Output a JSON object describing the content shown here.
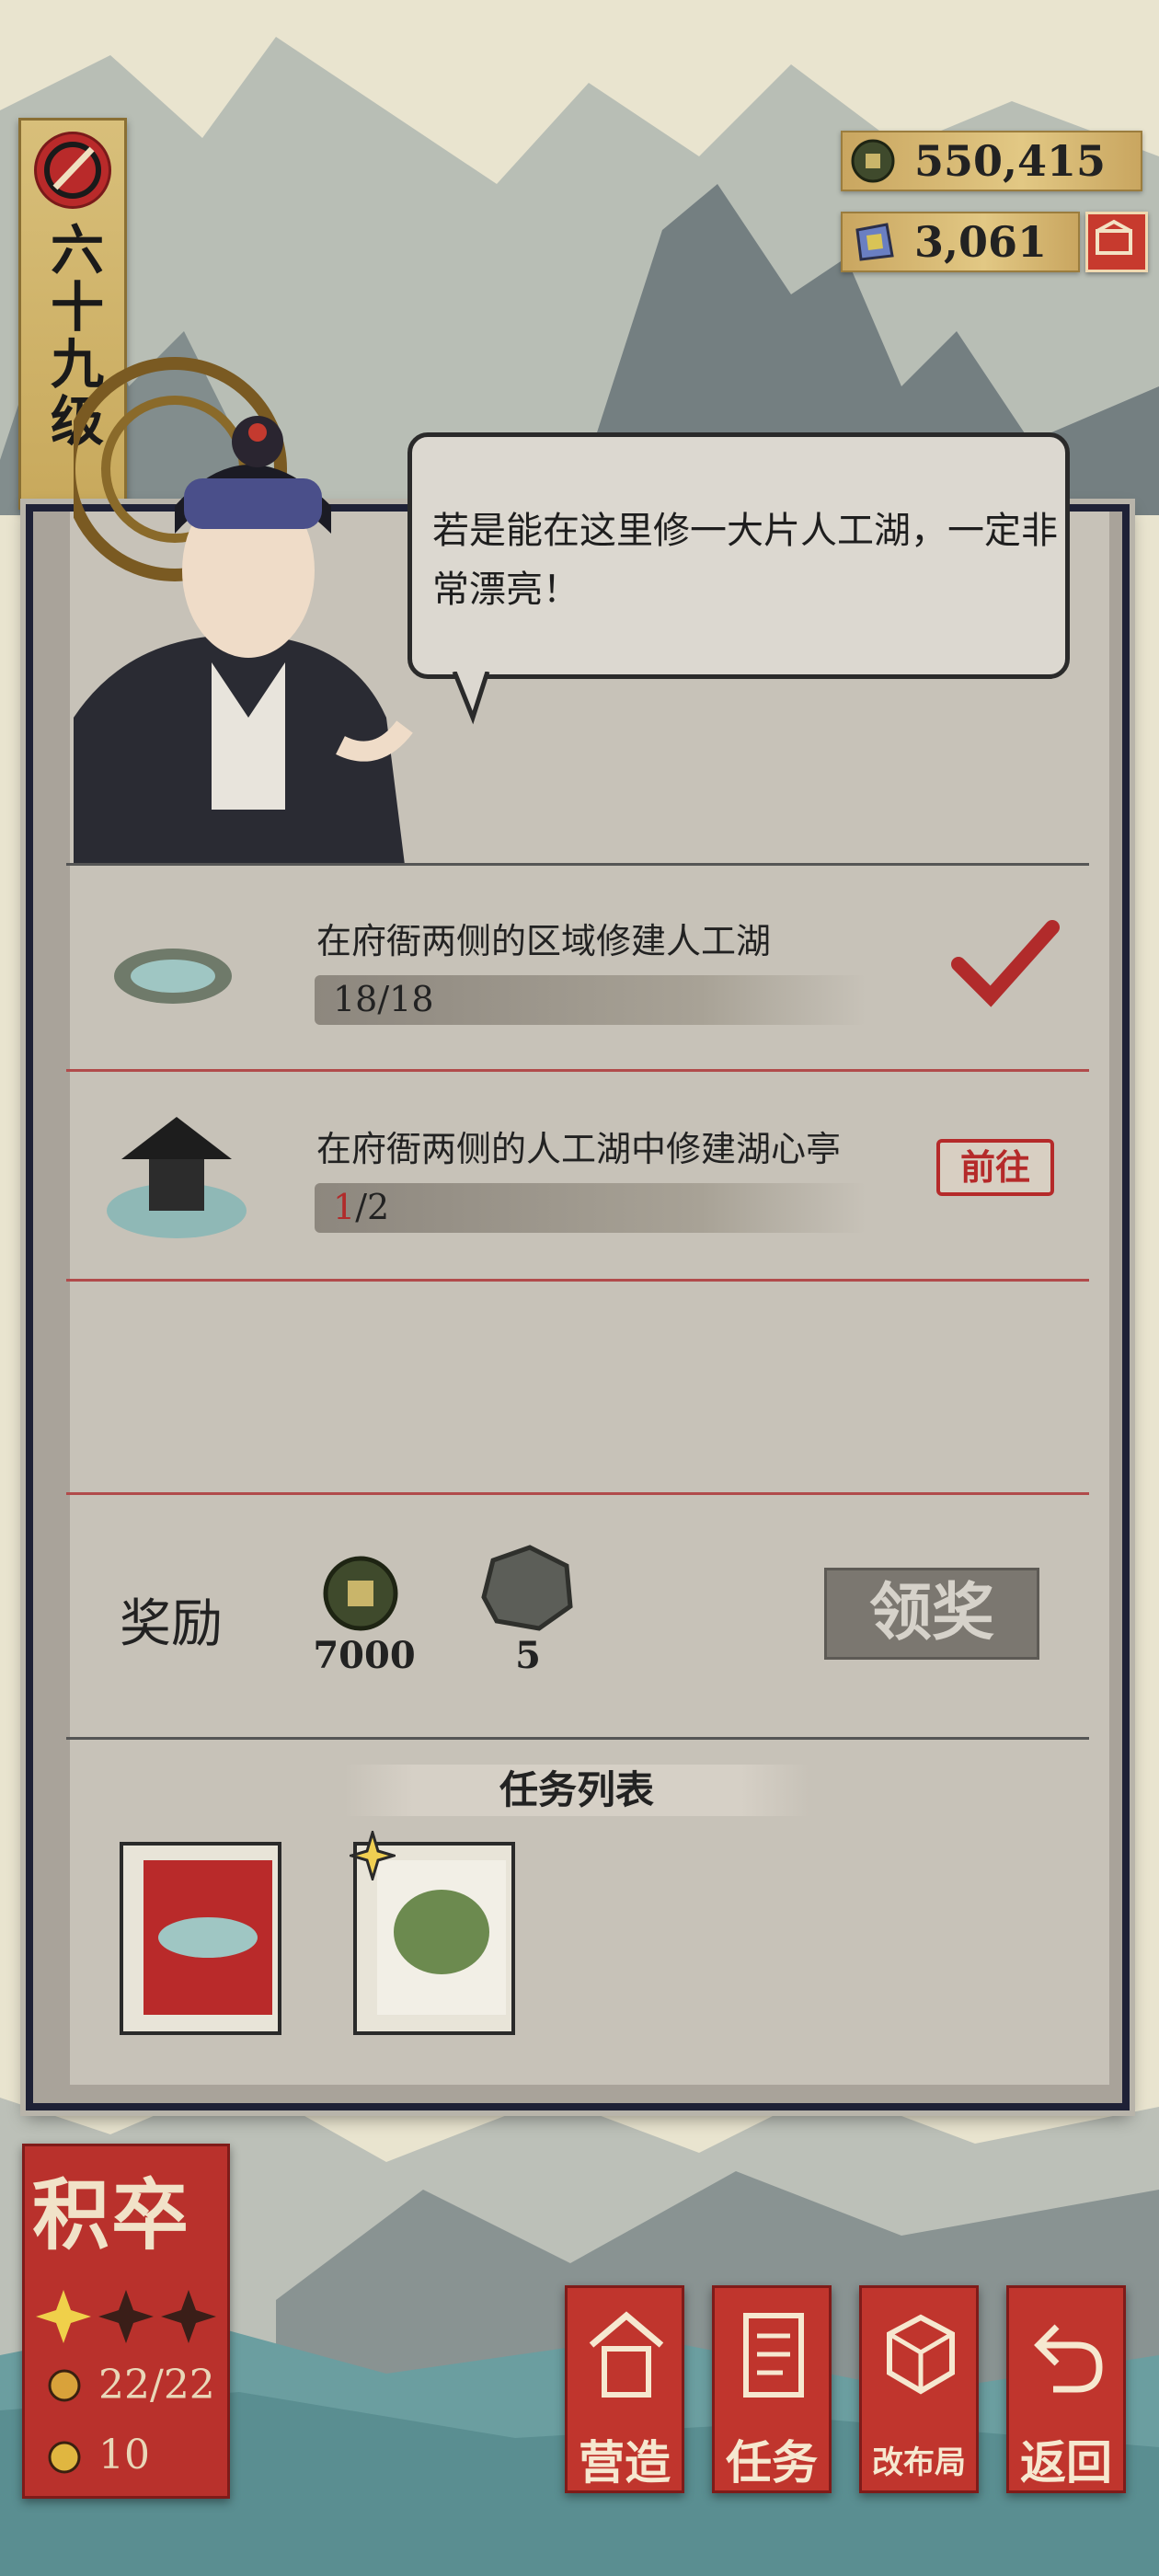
{
  "level": {
    "text": "六十九级"
  },
  "currency": {
    "coins": "550,415",
    "jade": "3,061"
  },
  "dialog": {
    "text": "若是能在这里修一大片人工湖，一定非常漂亮！"
  },
  "quests": [
    {
      "title": "在府衙两侧的区域修建人工湖",
      "progress": "18/18",
      "completed": true
    },
    {
      "title": "在府衙两侧的人工湖中修建湖心亭",
      "progress_current": "1",
      "progress_total": "/2",
      "action_label": "前往"
    }
  ],
  "reward": {
    "label": "奖励",
    "items": [
      {
        "icon": "coin-icon",
        "amount": "7000"
      },
      {
        "icon": "stone-icon",
        "amount": "5"
      }
    ],
    "claim_label": "领奖"
  },
  "task_list": {
    "title": "任务列表"
  },
  "rank": {
    "title": "积卒",
    "stars_filled": 1,
    "stars_total": 3,
    "workers": "22/22",
    "residents": "10"
  },
  "nav": {
    "build": "营造",
    "tasks": "任务",
    "layout": "改布局",
    "back": "返回"
  },
  "colors": {
    "accent_red": "#c0352d",
    "panel_border": "#1e2136",
    "gold": "#c9a660"
  }
}
